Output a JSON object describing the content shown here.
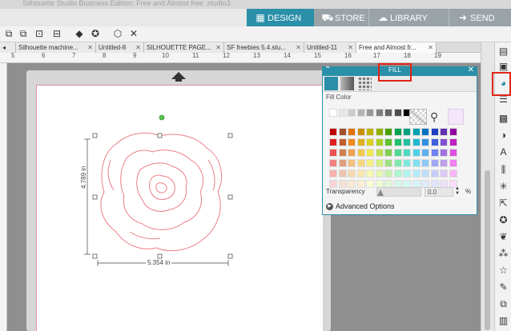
{
  "window": {
    "title": "Silhouette Studio Business Edition: Free and Almost free .studio3"
  },
  "nav": [
    {
      "label": "DESIGN",
      "icon": "grid-icon",
      "active": true
    },
    {
      "label": "STORE",
      "icon": "cart-icon"
    },
    {
      "label": "LIBRARY",
      "icon": "cloud-icon"
    },
    {
      "label": "SEND",
      "icon": "send-icon"
    }
  ],
  "doc_tabs": [
    {
      "label": "Silhouette machine..."
    },
    {
      "label": "Untitled-8"
    },
    {
      "label": "SILHOUETTE PAGE..."
    },
    {
      "label": "SF freebies 5.4.stu..."
    },
    {
      "label": "Untitled-11"
    },
    {
      "label": "Free and Almost fr...",
      "active": true
    }
  ],
  "ruler": {
    "ticks": [
      "5",
      "6",
      "7",
      "8",
      "9",
      "10",
      "11",
      "12",
      "13",
      "14",
      "15",
      "16",
      "17",
      "18",
      "19"
    ]
  },
  "fill_panel": {
    "title": "FILL",
    "section_label": "Fill Color",
    "transparency_label": "Transparency",
    "transparency_value": "0.0",
    "transparency_unit": "%",
    "advanced_label": "Advanced Options",
    "greys": [
      "#ffffff",
      "#e6e6e6",
      "#cccccc",
      "#b3b3b3",
      "#999999",
      "#808080",
      "#666666",
      "#4d4d4d",
      "#000000"
    ],
    "colors": [
      [
        "#c00000",
        "#a0522d",
        "#e07000",
        "#c89000",
        "#bdb000",
        "#8fb000",
        "#4aa000",
        "#00a050",
        "#00a080",
        "#00a0b0",
        "#0070c0",
        "#2040c0",
        "#6030b0",
        "#9000a0"
      ],
      [
        "#e02020",
        "#c06030",
        "#f08a20",
        "#e0b020",
        "#dcd020",
        "#a8d020",
        "#60c030",
        "#20c070",
        "#20c0a0",
        "#20b8d0",
        "#3090e0",
        "#4060e0",
        "#8050d0",
        "#c020c0"
      ],
      [
        "#f05050",
        "#d08050",
        "#f0a050",
        "#f0c850",
        "#f0e850",
        "#c0e050",
        "#80d050",
        "#50d890",
        "#50d8c0",
        "#50d0e8",
        "#60b0f0",
        "#7080f0",
        "#a070e0",
        "#e050e0"
      ],
      [
        "#f48080",
        "#e0a080",
        "#f4c080",
        "#f4d880",
        "#f4f080",
        "#d0f080",
        "#a0e080",
        "#80e8b0",
        "#80e8d8",
        "#80e0f0",
        "#90c8f4",
        "#a0a8f4",
        "#c0a0ec",
        "#f080f0"
      ],
      [
        "#f8b0b0",
        "#ecc4b0",
        "#f8dab0",
        "#f8e8b0",
        "#f8f8b0",
        "#e4f8b0",
        "#c8f0b0",
        "#b0f4d0",
        "#b0f4ec",
        "#b0ecf8",
        "#c0dcf8",
        "#c8ccf8",
        "#dcc8f4",
        "#f8b8f8"
      ],
      [
        "#f8d4d4",
        "#f4e0d4",
        "#fce8d4",
        "#fcf0d4",
        "#fcfcd4",
        "#eefcd4",
        "#e0f8d4",
        "#d4f8e8",
        "#d4f8f4",
        "#d4f4fc",
        "#dceafc",
        "#e0e4fc",
        "#ece0f8",
        "#fcdcfc"
      ]
    ],
    "custom_color": "#f5e6f9"
  },
  "dimensions": {
    "height": "4.789 in",
    "width": "5.354 in"
  },
  "colors": {
    "accent": "#2a8fa8",
    "highlight": "#e0251b",
    "cut_line": "#ea7d86",
    "mat_border": "#e08a9a"
  }
}
